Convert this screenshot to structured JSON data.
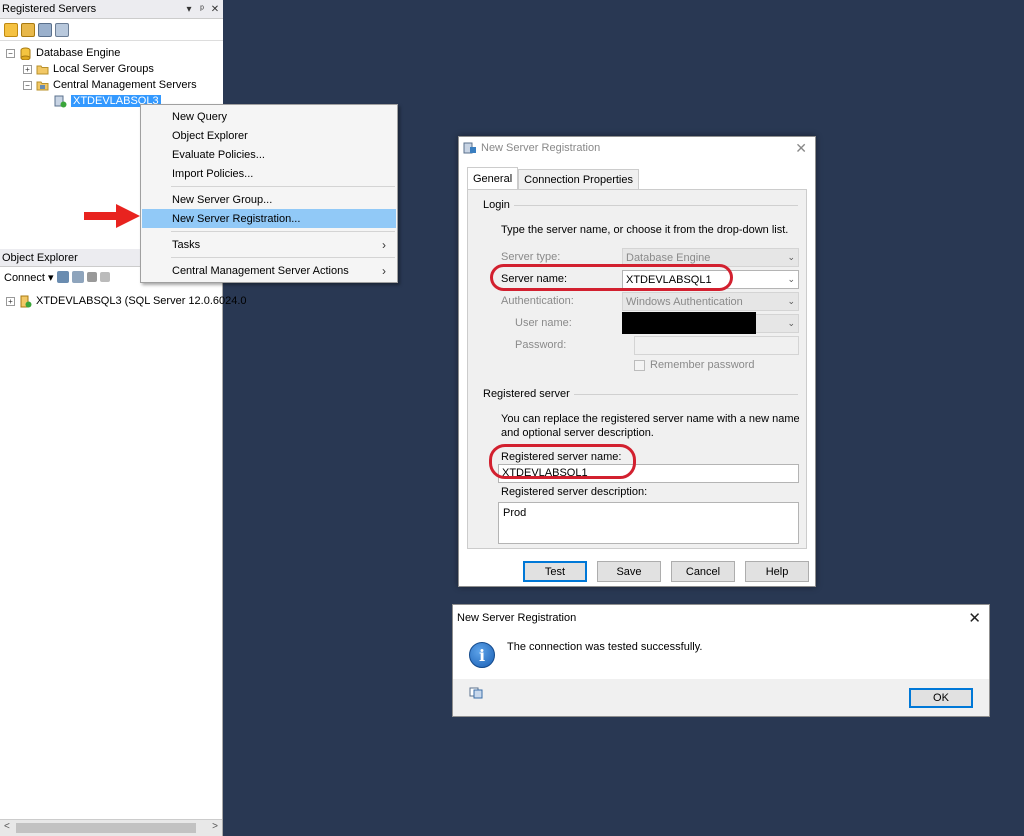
{
  "registered_servers": {
    "title": "Registered Servers",
    "controls": [
      "▾",
      "ᵖ",
      "✕"
    ],
    "tree": {
      "database_engine": "Database Engine",
      "local_server_groups": "Local Server Groups",
      "central_management_servers": "Central Management Servers",
      "selected_server": "XTDEVLABSQL3"
    }
  },
  "context_menu": {
    "items": [
      {
        "label": "New Query"
      },
      {
        "label": "Object Explorer"
      },
      {
        "label": "Evaluate Policies..."
      },
      {
        "label": "Import Policies..."
      },
      {
        "label": "New Server Group..."
      },
      {
        "label": "New Server Registration..."
      },
      {
        "label": "Tasks",
        "submenu": true
      },
      {
        "label": "Central Management Server Actions",
        "submenu": true
      }
    ],
    "highlighted": "New Server Registration..."
  },
  "object_explorer": {
    "title": "Object Explorer",
    "connect_label": "Connect ▾",
    "server_node": "XTDEVLABSQL3 (SQL Server 12.0.6024.0"
  },
  "dialog": {
    "title": "New Server Registration",
    "tabs": [
      "General",
      "Connection Properties"
    ],
    "login_group": "Login",
    "login_instructions": "Type the server name, or choose it from the drop-down list.",
    "server_type_label": "Server type:",
    "server_type_value": "Database Engine",
    "server_name_label": "Server name:",
    "server_name_value": "XTDEVLABSQL1",
    "authentication_label": "Authentication:",
    "authentication_value": "Windows Authentication",
    "user_name_label": "User name:",
    "password_label": "Password:",
    "remember_password_label": "Remember password",
    "registered_group": "Registered server",
    "registered_instructions_1": "You can replace the registered server name with a new name",
    "registered_instructions_2": "and optional server description.",
    "registered_name_label": "Registered server name:",
    "registered_name_value": "XTDEVLABSQL1",
    "registered_desc_label": "Registered server description:",
    "registered_desc_value": "Prod",
    "buttons": {
      "test": "Test",
      "save": "Save",
      "cancel": "Cancel",
      "help": "Help"
    }
  },
  "message_box": {
    "title": "New Server Registration",
    "message": "The connection was tested successfully.",
    "ok_label": "OK"
  },
  "colors": {
    "background": "#293853",
    "highlight": "#91c9f7",
    "selection": "#3399ff",
    "annotation_red": "#d2202f"
  }
}
